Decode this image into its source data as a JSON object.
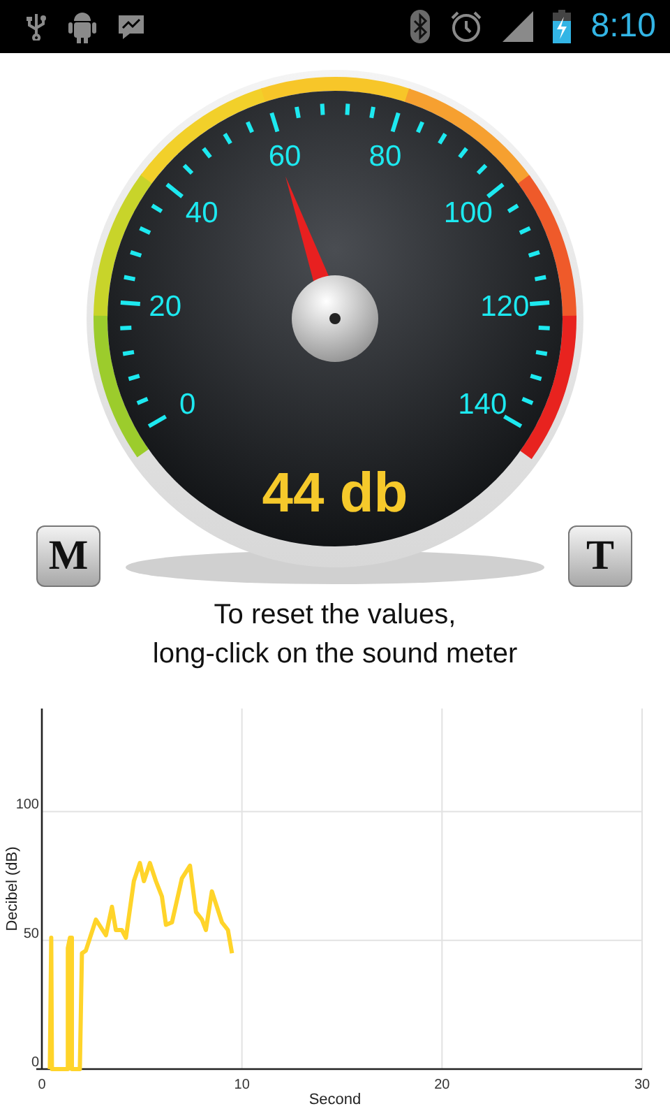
{
  "status_bar": {
    "time": "8:10"
  },
  "meter": {
    "dial_labels": [
      "0",
      "20",
      "40",
      "60",
      "80",
      "100",
      "120",
      "140"
    ],
    "needle": {
      "level": 0.42
    },
    "reading": "44 db"
  },
  "buttons": [
    {
      "label": "M"
    },
    {
      "label": "T"
    }
  ],
  "hint": [
    "To reset the values,",
    "long-click on the sound meter"
  ],
  "chart": {
    "chart_data": {
      "type": "line",
      "xlabel": "Second",
      "ylabel": "Decibel (dB)",
      "xlim": [
        0,
        30
      ],
      "ylim": [
        0,
        140
      ],
      "xticks": [
        0,
        10,
        20,
        30
      ],
      "yticks": [
        0,
        50,
        100
      ],
      "grid": true,
      "x": [
        0.4,
        0.47,
        0.5,
        1.3,
        1.3,
        1.4,
        1.5,
        1.5,
        1.9,
        2.0,
        2.2,
        2.7,
        3.2,
        3.5,
        3.7,
        4.0,
        4.2,
        4.6,
        4.9,
        5.1,
        5.4,
        5.7,
        6.0,
        6.2,
        6.5,
        7.0,
        7.4,
        7.7,
        8.0,
        8.2,
        8.5,
        9.0,
        9.3,
        9.5
      ],
      "series": [
        {
          "color": "#ffd42a",
          "values": [
            0,
            51,
            0,
            0,
            47,
            51,
            51,
            0,
            0,
            45,
            46,
            58,
            52,
            63,
            54,
            54,
            51,
            73,
            80,
            73,
            80,
            73,
            67,
            56,
            57,
            74,
            79,
            61,
            58,
            54,
            69,
            57,
            54,
            45
          ]
        }
      ]
    }
  }
}
